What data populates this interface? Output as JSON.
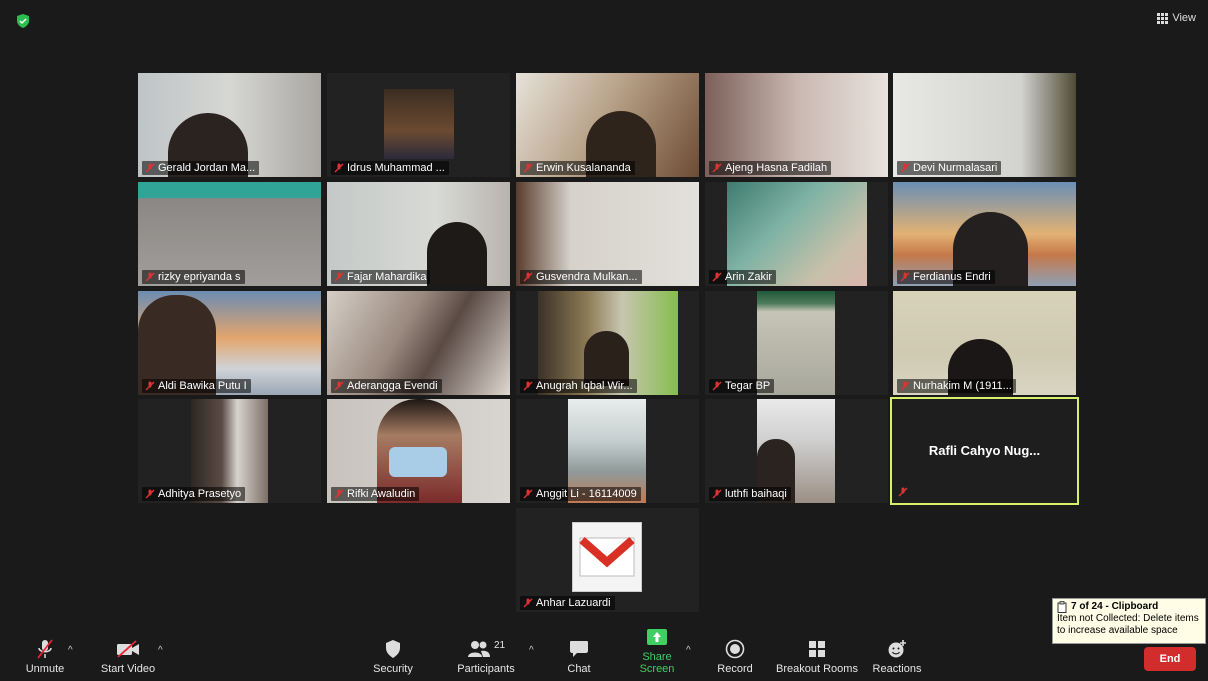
{
  "topbar": {
    "view_label": "View"
  },
  "participants_tiles": [
    "Gerald Jordan Ma...",
    "Idrus Muhammad ...",
    "Erwin Kusalananda",
    "Ajeng Hasna Fadilah",
    "Devi Nurmalasari",
    "rizky epriyanda s",
    "Fajar Mahardika",
    "Gusvendra Mulkan...",
    "Arin Zakir",
    "Ferdianus Endri",
    "Aldi Bawika Putu I",
    "Aderangga Evendi",
    "Anugrah Iqbal Wir...",
    "Tegar BP",
    "Nurhakim M (1911...",
    "Adhitya Prasetyo",
    "Rifki Awaludin",
    "Anggit Li - 16114009",
    "luthfi baihaqi",
    "Rafli Cahyo Nug...",
    "Anhar Lazuardi"
  ],
  "active_speaker": "Rafli Cahyo Nug...",
  "toolbar": {
    "unmute": "Unmute",
    "start_video": "Start Video",
    "security": "Security",
    "participants": "Participants",
    "participants_count": "21",
    "chat": "Chat",
    "share_screen": "Share Screen",
    "record": "Record",
    "breakout_rooms": "Breakout Rooms",
    "reactions": "Reactions",
    "end": "End"
  },
  "clipboard": {
    "title": "7 of 24 - Clipboard",
    "message": "Item not Collected: Delete items to increase available space"
  },
  "colors": {
    "accent_green": "#3fcf63",
    "end_red": "#d12d2d",
    "active_border": "#d6f06a"
  }
}
